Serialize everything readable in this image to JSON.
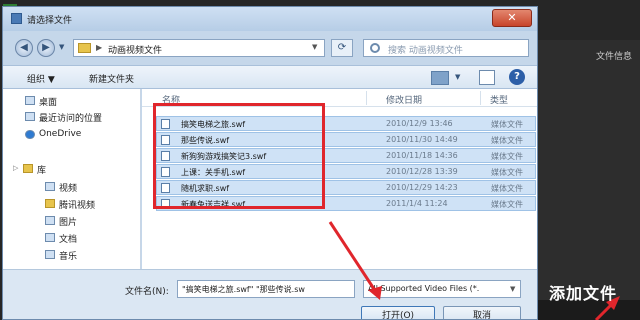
{
  "app": {
    "right_panel_label": "文件信息",
    "add_file_label": "添加文件"
  },
  "dialog": {
    "title": "请选择文件",
    "close_glyph": "✕",
    "address": {
      "path": "动画视频文件",
      "separator": "▶",
      "dropdown_glyph": "▼"
    },
    "search_placeholder": "搜索 动画视频文件",
    "toolbar": {
      "organize_label": "组织 ▼",
      "new_folder_label": "新建文件夹",
      "help_glyph": "?"
    },
    "nav": {
      "favorites": [
        {
          "label": "桌面"
        },
        {
          "label": "最近访问的位置"
        }
      ],
      "onedrive": "OneDrive",
      "library_group": "库",
      "libraries": [
        {
          "label": "视频"
        },
        {
          "label": "腾讯视频"
        },
        {
          "label": "图片"
        },
        {
          "label": "文档"
        },
        {
          "label": "音乐"
        }
      ]
    },
    "columns": {
      "name": "名称",
      "date": "修改日期",
      "type": "类型"
    },
    "files": [
      {
        "name": "搞笑电梯之旅.swf",
        "date": "2010/12/9 13:46",
        "type": "媒体文件"
      },
      {
        "name": "那些传说.swf",
        "date": "2010/11/30 14:49",
        "type": "媒体文件"
      },
      {
        "name": "新狗狗游戏搞笑记3.swf",
        "date": "2010/11/18 14:36",
        "type": "媒体文件"
      },
      {
        "name": "上课：关手机.swf",
        "date": "2010/12/28 13:39",
        "type": "媒体文件"
      },
      {
        "name": "随机求职.swf",
        "date": "2010/12/29 14:23",
        "type": "媒体文件"
      },
      {
        "name": "新春兔送吉祥.swf",
        "date": "2011/1/4 11:24",
        "type": "媒体文件"
      }
    ],
    "filename_label": "文件名(N):",
    "filename_value": "\"搞笑电梯之旅.swf\" \"那些传说.sw",
    "file_type_filter": "All Supported Video Files (*.",
    "open_button": "打开(O)",
    "cancel_button": "取消"
  },
  "colors": {
    "highlight": "#e0262c",
    "selection": "#cfe2f6"
  }
}
